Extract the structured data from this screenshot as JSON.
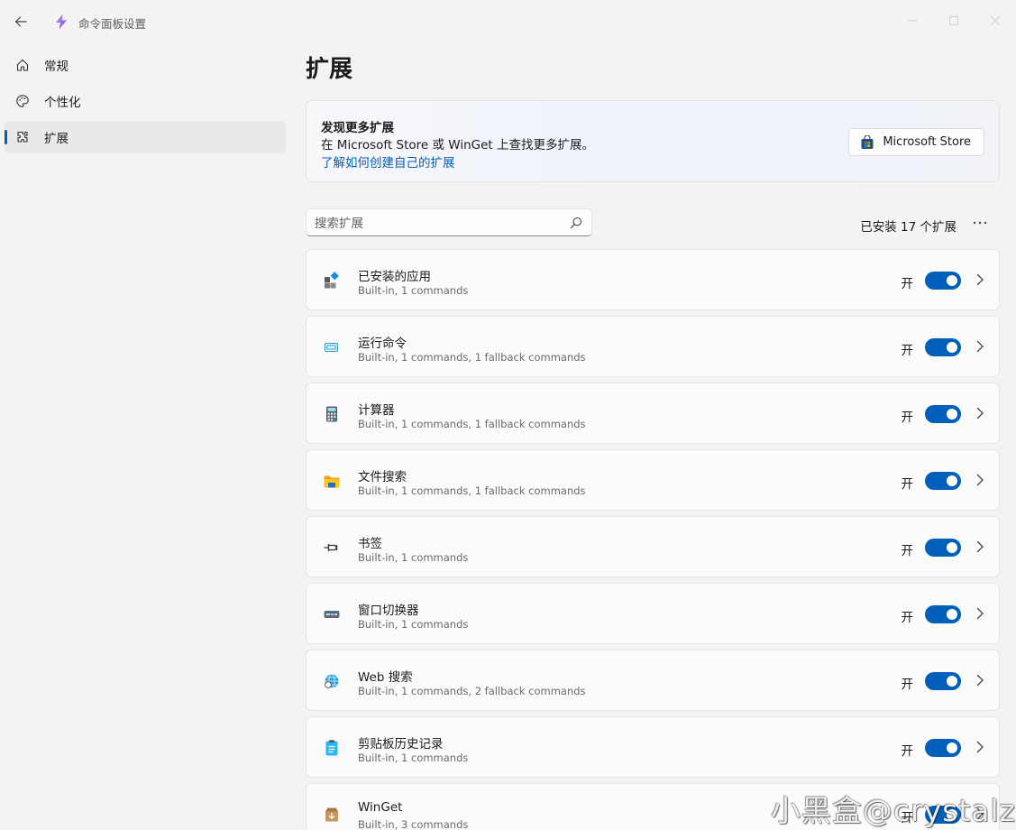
{
  "window": {
    "title": "命令面板设置"
  },
  "sidebar": {
    "items": [
      {
        "label": "常规",
        "icon": "home-icon",
        "active": false
      },
      {
        "label": "个性化",
        "icon": "palette-icon",
        "active": false
      },
      {
        "label": "扩展",
        "icon": "puzzle-icon",
        "active": true
      }
    ]
  },
  "page": {
    "title": "扩展"
  },
  "promo": {
    "title": "发现更多扩展",
    "description": "在 Microsoft Store 或 WinGet 上查找更多扩展。",
    "link": "了解如何创建自己的扩展",
    "store_button": "Microsoft Store"
  },
  "search": {
    "placeholder": "搜索扩展",
    "value": ""
  },
  "installed_count": "已安装 17 个扩展",
  "toggle_on_label": "开",
  "extensions": [
    {
      "name": "已安装的应用",
      "meta": "Built-in, 1 commands",
      "icon": "apps-icon",
      "enabled": true
    },
    {
      "name": "运行命令",
      "meta": "Built-in, 1 commands, 1 fallback commands",
      "icon": "run-icon",
      "enabled": true
    },
    {
      "name": "计算器",
      "meta": "Built-in, 1 commands, 1 fallback commands",
      "icon": "calculator-icon",
      "enabled": true
    },
    {
      "name": "文件搜索",
      "meta": "Built-in, 1 commands, 1 fallback commands",
      "icon": "folder-icon",
      "enabled": true
    },
    {
      "name": "书签",
      "meta": "Built-in, 1 commands",
      "icon": "pin-icon",
      "enabled": true
    },
    {
      "name": "窗口切换器",
      "meta": "Built-in, 1 commands",
      "icon": "window-switcher-icon",
      "enabled": true
    },
    {
      "name": "Web 搜索",
      "meta": "Built-in, 1 commands, 2 fallback commands",
      "icon": "globe-search-icon",
      "enabled": true
    },
    {
      "name": "剪贴板历史记录",
      "meta": "Built-in, 1 commands",
      "icon": "clipboard-icon",
      "enabled": true
    },
    {
      "name": "WinGet",
      "meta": "Built-in, 3 commands",
      "icon": "package-icon",
      "enabled": true
    }
  ],
  "watermark": "小黑盒@crystalz",
  "colors": {
    "accent": "#005fb8",
    "background": "#f3f3f3",
    "card": "#fbfbfb"
  }
}
